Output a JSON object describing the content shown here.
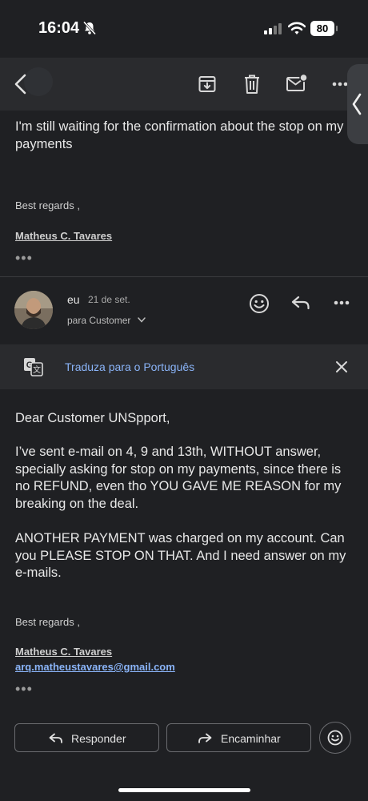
{
  "status_bar": {
    "time": "16:04",
    "battery": "80"
  },
  "toolbar": {
    "back_icon": "chevron-left-icon",
    "archive_icon": "archive-icon",
    "delete_icon": "trash-icon",
    "mark_unread_icon": "mail-dot-icon",
    "more_icon": "more-horizontal-icon"
  },
  "previous_message": {
    "body": "I'm still waiting for the confirmation about the stop on my payments",
    "closing": "Best regards ,",
    "signature_name": "Matheus C. Tavares",
    "ellipsis": "•••"
  },
  "message": {
    "sender": "eu",
    "date": "21 de set.",
    "recipient": "para Customer",
    "translate_label": "Traduza para o Português",
    "greeting": "Dear Customer UNSpport,",
    "paragraph1": "I’ve sent e-mail on 4, 9 and 13th, WITHOUT answer, specially asking for stop on my payments, since there is no REFUND, even tho YOU GAVE ME REASON for my breaking on the deal.",
    "paragraph2": "ANOTHER PAYMENT was charged on my account. Can you PLEASE STOP ON THAT. And I need answer on my e-mails.",
    "closing": "Best regards ,",
    "signature_name": "Matheus C. Tavares",
    "signature_email": "arq.matheustavares@gmail.com",
    "ellipsis": "•••"
  },
  "actions": {
    "reply": "Responder",
    "forward": "Encaminhar"
  },
  "colors": {
    "background": "#1f2023",
    "link": "#8ab4f8",
    "toolbar": "#2a2b2e"
  }
}
